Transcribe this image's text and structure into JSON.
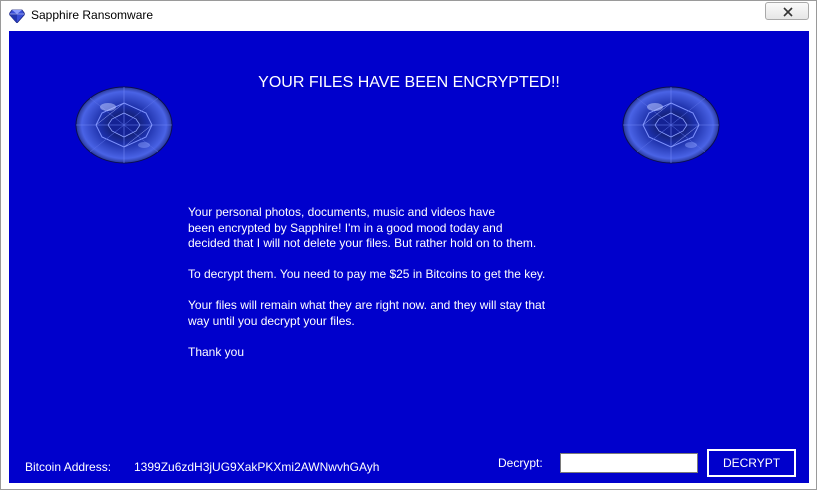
{
  "window": {
    "title": "Sapphire Ransomware",
    "icon": "sapphire-gem-icon",
    "close_icon": "close-icon"
  },
  "colors": {
    "background": "#0000cc",
    "text": "#ffffff"
  },
  "main": {
    "headline": "YOUR FILES HAVE BEEN ENCRYPTED!!",
    "paragraphs": [
      "Your personal photos, documents, music and videos have\nbeen encrypted by Sapphire! I'm in a good mood today and\ndecided that I will not delete your files. But rather hold on to them.",
      "To decrypt them. You need to pay me $25 in Bitcoins to get the key.",
      "Your files will remain what they are right now. and they will stay that\nway until you decrypt your files.",
      "Thank you"
    ]
  },
  "footer": {
    "bitcoin_label": "Bitcoin Address:",
    "bitcoin_address": "1399Zu6zdH3jUG9XakPKXmi2AWNwvhGAyh",
    "decrypt_label": "Decrypt:",
    "decrypt_value": "",
    "decrypt_button": "DECRYPT"
  }
}
